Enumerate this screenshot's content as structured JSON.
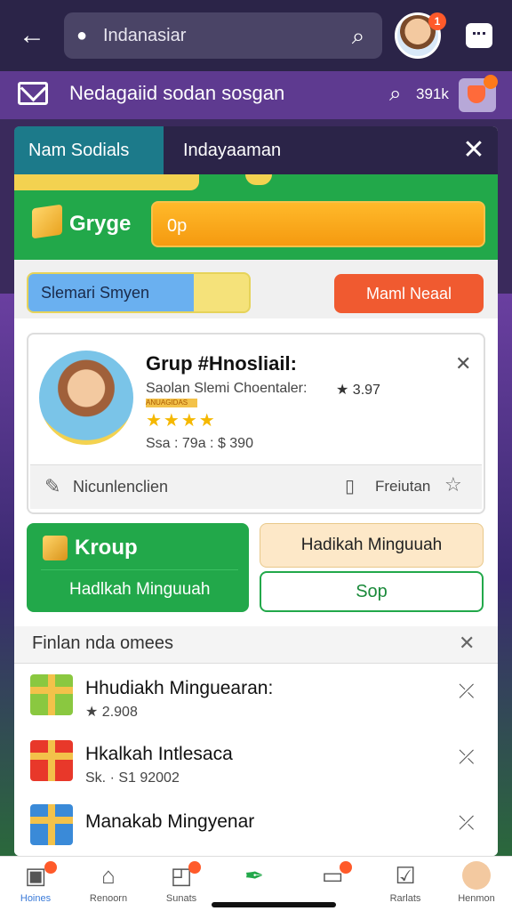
{
  "topbar": {
    "search_text": "Indanasiar",
    "avatar_badge": "1"
  },
  "subbar": {
    "title": "Nedagaiid sodan sosgan",
    "count": "391k"
  },
  "modal": {
    "tab_active": "Nam Sodials",
    "tab_other": "Indayaaman",
    "green_label": "Gryge",
    "orange_input_value": "0p",
    "blue_pill": "Slemari Smyen",
    "red_pill": "Maml Neaal"
  },
  "group_card": {
    "title": "Grup #Hnosliail:",
    "subtitle": "Saolan Slemi Choentaler:",
    "rating": "3.97",
    "pill": "ANUAGIDAS",
    "stars": "★★★★",
    "stats": "Ssa : 79a : $ 390",
    "left_text": "Nicunlenclien",
    "right_text": "Freiutan"
  },
  "group_block": {
    "title": "Kroup",
    "subtitle": "Hadlkah Minguuah",
    "hadiah_button": "Hadikah Minguuah",
    "sop_button": "Sop"
  },
  "list": {
    "header": "Finlan nda omees",
    "items": [
      {
        "title": "Hhudiakh Minguearan:",
        "meta": "2.908"
      },
      {
        "title": "Hkalkah Intlesaca",
        "meta": "Sk. · S1 92002"
      },
      {
        "title": "Manakab Mingyenar",
        "meta": ""
      }
    ]
  },
  "bottom_nav": [
    {
      "label": "Hoines"
    },
    {
      "label": "Renoorn"
    },
    {
      "label": "Sunats"
    },
    {
      "label": ""
    },
    {
      "label": ""
    },
    {
      "label": "Rarlats"
    },
    {
      "label": "Henmon"
    }
  ],
  "colors": {
    "topbar": "#2b2448",
    "subbar": "#5e3a90",
    "green": "#22a84a",
    "orange": "#f59a10",
    "red": "#f05a30"
  }
}
